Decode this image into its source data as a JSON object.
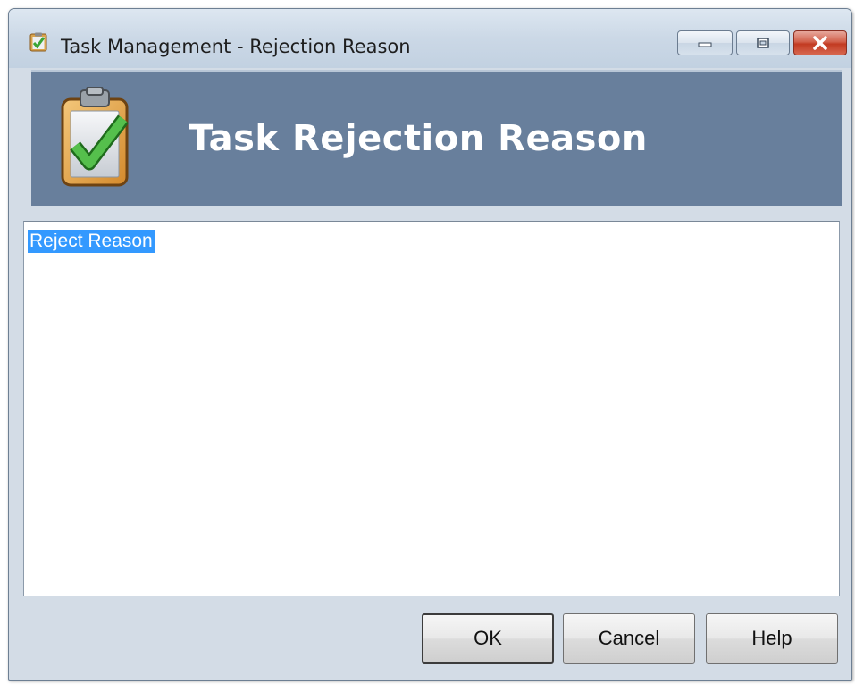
{
  "window": {
    "title": "Task Management - Rejection Reason",
    "icon": "clipboard-check-icon"
  },
  "titlebar_buttons": {
    "minimize": "minimize-icon",
    "maximize": "maximize-icon",
    "close": "close-icon"
  },
  "banner": {
    "title": "Task Rejection Reason",
    "icon": "clipboard-check-icon",
    "background": "#687f9c"
  },
  "reason_field": {
    "value": "Reject Reason",
    "selected": true,
    "selection_color": "#3399ff"
  },
  "buttons": {
    "ok": "OK",
    "cancel": "Cancel",
    "help": "Help"
  }
}
